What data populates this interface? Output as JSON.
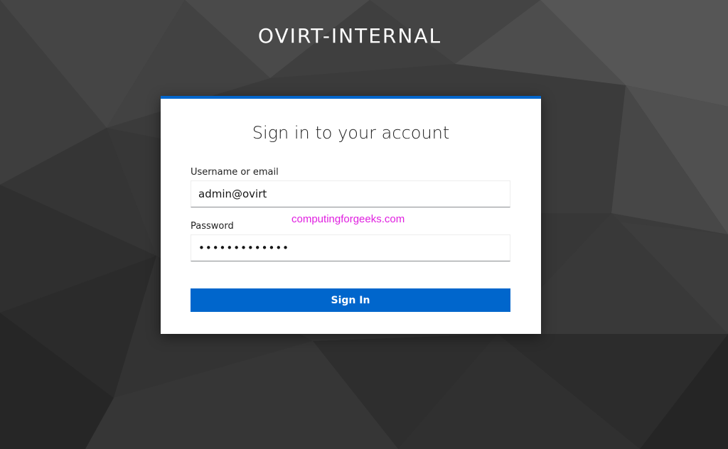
{
  "realm": {
    "title": "OVIRT-INTERNAL"
  },
  "login": {
    "heading": "Sign in to your account",
    "username_label": "Username or email",
    "username_value": "admin@ovirt",
    "password_label": "Password",
    "password_value": "•••••••••••••",
    "submit_label": "Sign In"
  },
  "watermark": {
    "text": "computingforgeeks.com"
  },
  "colors": {
    "accent": "#0066cc",
    "background": "#3a3a3a",
    "watermark": "#e020e0"
  }
}
